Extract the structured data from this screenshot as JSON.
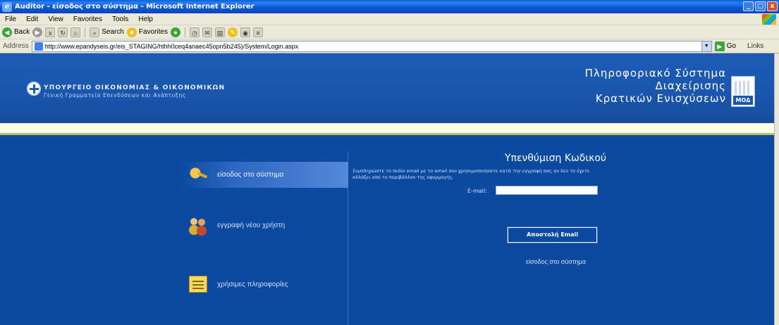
{
  "window": {
    "title": "Auditor - είσοδος στο σύστημα - Microsoft Internet Explorer",
    "controls": [
      "_",
      "□",
      "x"
    ]
  },
  "menubar": {
    "items": [
      "File",
      "Edit",
      "View",
      "Favorites",
      "Tools",
      "Help"
    ]
  },
  "toolbar": {
    "back": "Back",
    "search": "Search",
    "favorites": "Favorites"
  },
  "address": {
    "label": "Address",
    "url": "http://www.epandyseis.gr/eis_STAGING/hthh0ceq4anaec45opn5b245)/System/Login.aspx",
    "go": "Go",
    "links": "Links"
  },
  "header": {
    "ministry_line1": "ΥΠΟΥΡΓΕΙΟ ΟΙΚΟΝΟΜΙΑΣ & ΟΙΚΟΝΟΜΙΚΩΝ",
    "ministry_line2": "Γενική Γραμματεία Επενδύσεων και Ανάπτυξης",
    "system_line1": "Πληροφοριακό Σύστημα",
    "system_line2": "Διαχείρισης",
    "system_line3": "Κρατικών Ενισχύσεων",
    "logo_text": "ΜΟΔ"
  },
  "menu": {
    "login": "είσοδος στο σύστημα",
    "register": "εγγραφή νέου χρήστη",
    "info": "χρήσιμες πληροφορίες"
  },
  "recover": {
    "title": "Υπενθύμιση Κωδικού",
    "description": "Συμπληρώστε το πεδίο email με το email που χρησιμοποιήσατε κατά την εγγραφή σας αν δεν το έχετε αλλάξει από το περιβάλλον της εφαρμογής.",
    "email_label": "E-mail:",
    "email_value": "",
    "send_button": "Αποστολή Email",
    "login_link": "είσοδος στο σύστημα"
  }
}
